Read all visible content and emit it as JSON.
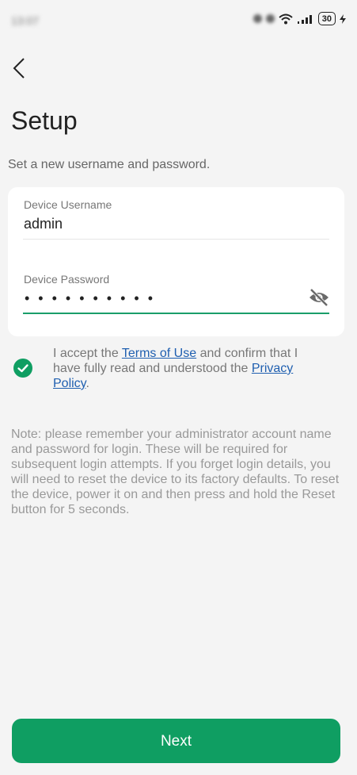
{
  "status_bar": {
    "time": "13:07",
    "battery": "30"
  },
  "icons": {
    "back": "chevron-left-icon",
    "visibility": "eye-slash-icon",
    "check": "check-circle-icon"
  },
  "page": {
    "title": "Setup",
    "subtitle": "Set a new username and password."
  },
  "form": {
    "username_label": "Device Username",
    "username_value": "admin",
    "password_label": "Device Password",
    "password_masked": "••••••••••"
  },
  "terms": {
    "checked": true,
    "prefix": "I accept the ",
    "terms_link": "Terms of Use",
    "middle": " and confirm that I have fully read and understood the ",
    "privacy_link": "Privacy Policy",
    "suffix": "."
  },
  "note": "Note: please remember your administrator account name and password for login. These will be required for subsequent login attempts. If you forget login details, you will need to reset the device to its factory defaults. To reset the device, power it on and then press and hold the Reset button for 5 seconds.",
  "next_button": "Next",
  "colors": {
    "accent": "#0f9e62",
    "link": "#1f5fb0",
    "background": "#f4f4f4"
  }
}
